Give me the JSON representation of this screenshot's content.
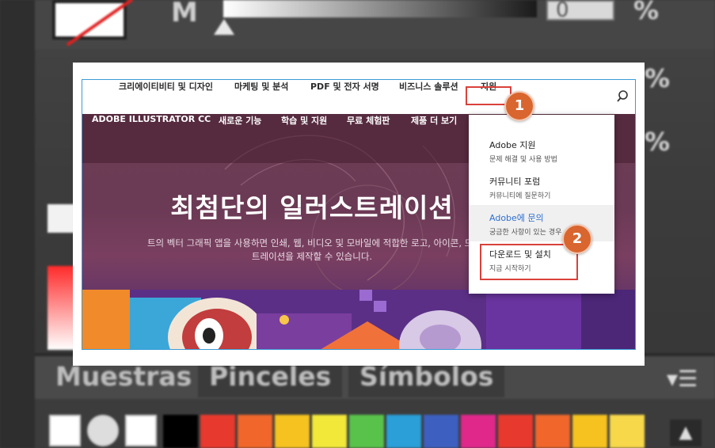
{
  "background": {
    "slider_letter": "M",
    "value_box": "0",
    "percent_sign": "%",
    "panel_tabs": [
      "Muestras",
      "Pinceles",
      "Símbolos"
    ],
    "swatch_colors": [
      "#000000",
      "#e8392e",
      "#f0662b",
      "#f5c21f",
      "#f1e83a",
      "#59c24a",
      "#2a9fd8",
      "#3d5fc0",
      "#e0288b",
      "#e8392e",
      "#f0662b",
      "#f5c21f",
      "#f7d84a"
    ]
  },
  "global_nav": {
    "items": [
      "크리에이티비티 및 디자인",
      "마케팅 및 분석",
      "PDF 및 전자 서명",
      "비즈니스 솔루션",
      "지원"
    ]
  },
  "product_nav": {
    "items": [
      "ADOBE ILLUSTRATOR CC",
      "새로운 기능",
      "학습 및 지원",
      "무료 체험판",
      "제품 더 보기"
    ]
  },
  "hero": {
    "title": "최첨단의 일러스트레이션",
    "subtitle_line1": "트의 벡터 그래픽 앱을 사용하면 인쇄, 웹, 비디오 및 모바일에 적합한 로고, 아이콘, 드로잉,",
    "subtitle_line2": "트레이션을 제작할 수 있습니다."
  },
  "dropdown": {
    "items": [
      {
        "label": "Adobe 지원",
        "desc": "문제 해결 및 사용 방법"
      },
      {
        "label": "커뮤니티 포럼",
        "desc": "커뮤니티에 질문하기"
      },
      {
        "label": "Adobe에 문의",
        "desc": "궁금한 사항이 있는 경우"
      },
      {
        "label": "다운로드 및 설치",
        "desc": "지금 시작하기"
      }
    ]
  },
  "annotations": {
    "badge1": "1",
    "badge2": "2",
    "highlight_color": "#d9413b",
    "badge_color": "#d9652f"
  }
}
